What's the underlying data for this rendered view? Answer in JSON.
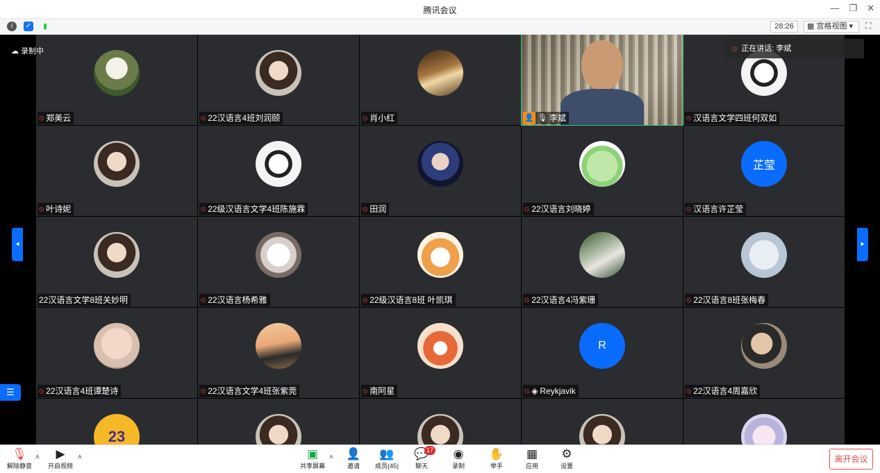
{
  "window": {
    "title": "腾讯会议"
  },
  "infobar": {
    "timer": "28:26",
    "view_label": "宫格视图"
  },
  "stage": {
    "recording_label": "录制中",
    "speaking_label": "正在讲话: 李斌"
  },
  "participants": [
    {
      "name": "郑美云",
      "mic": "off",
      "avatar": "house"
    },
    {
      "name": "22汉语言4班刘润颐",
      "mic": "off",
      "avatar": "portrait"
    },
    {
      "name": "肖小红",
      "mic": "off",
      "avatar": "book"
    },
    {
      "name": "李斌",
      "mic": "on",
      "avatar": "video",
      "host": true
    },
    {
      "name": "汉语言文学四班何双如",
      "mic": "off",
      "avatar": "manga"
    },
    {
      "name": "叶诗妮",
      "mic": "off",
      "avatar": "portrait"
    },
    {
      "name": "22级汉语言文学4班陈施霖",
      "mic": "off",
      "avatar": "manga"
    },
    {
      "name": "田润",
      "mic": "off",
      "avatar": "portrait-blue"
    },
    {
      "name": "22汉语言刘晓婷",
      "mic": "off",
      "avatar": "frog"
    },
    {
      "name": "汉语言许芷莹",
      "mic": "off",
      "avatar": "text",
      "avatar_text": "芷莹"
    },
    {
      "name": "22汉语言文学8班关妙明",
      "mic": "none",
      "avatar": "portrait"
    },
    {
      "name": "22汉语言杨希雅",
      "mic": "off",
      "avatar": "dog"
    },
    {
      "name": "22级汉语言8班 叶凯琪",
      "mic": "off",
      "avatar": "shiba"
    },
    {
      "name": "22汉语言4冯紫珊",
      "mic": "off",
      "avatar": "tree"
    },
    {
      "name": "22汉语言8班张梅春",
      "mic": "off",
      "avatar": "snow"
    },
    {
      "name": "22汉语言4班谭楚诗",
      "mic": "off",
      "avatar": "baby"
    },
    {
      "name": "22汉语言文学4班张紫莞",
      "mic": "off",
      "avatar": "beach"
    },
    {
      "name": "南阿星",
      "mic": "off",
      "avatar": "fox"
    },
    {
      "name": "Reykjavik",
      "mic": "off",
      "avatar": "text",
      "avatar_text": "R",
      "device_icon": true
    },
    {
      "name": "22汉语言4周嘉欣",
      "mic": "off",
      "avatar": "cat"
    },
    {
      "name": "",
      "mic": "none",
      "avatar": "lakers",
      "avatar_text": "23"
    },
    {
      "name": "",
      "mic": "none",
      "avatar": "portrait"
    },
    {
      "name": "",
      "mic": "none",
      "avatar": "portrait"
    },
    {
      "name": "",
      "mic": "none",
      "avatar": "portrait"
    },
    {
      "name": "",
      "mic": "none",
      "avatar": "anime"
    }
  ],
  "toolbar": {
    "unmute": "解除静音",
    "start_video": "开启视频",
    "share_screen": "共享屏幕",
    "invite": "邀请",
    "members": "成员(45)",
    "chat": "聊天",
    "chat_badge": "17",
    "record": "录制",
    "raise_hand": "举手",
    "apps": "应用",
    "settings": "设置",
    "leave": "离开会议"
  },
  "colors": {
    "accent": "#0a6cff",
    "danger": "#e84c4c",
    "tile_bg": "#2b2c2f"
  }
}
